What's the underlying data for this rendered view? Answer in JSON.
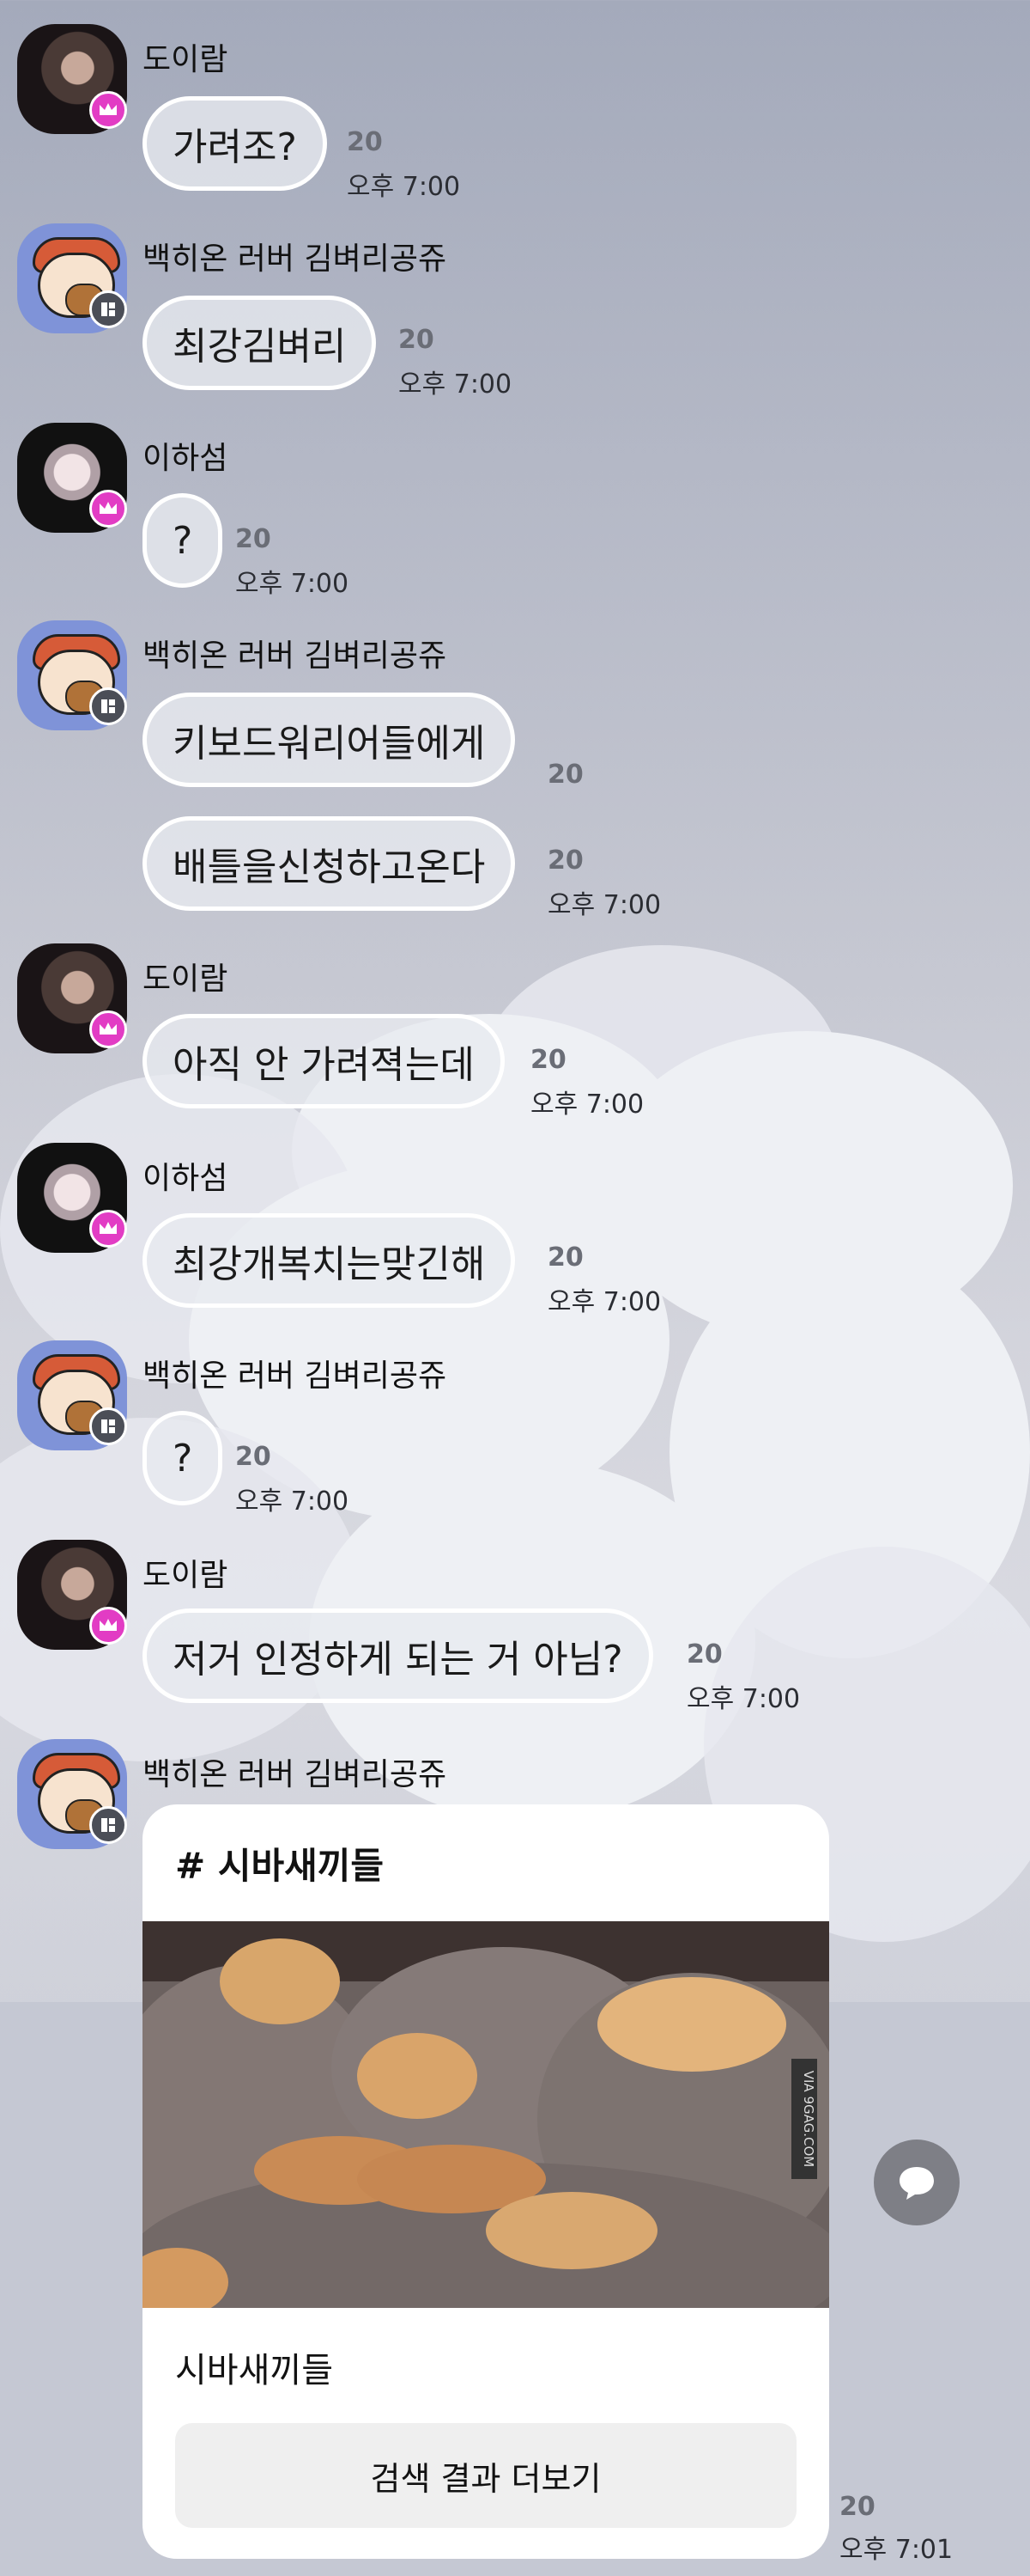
{
  "messages": [
    {
      "sender": "도이람",
      "text": "가려조?",
      "count": "20",
      "time": "오후 7:00"
    },
    {
      "sender": "백히온 러버 김벼리공쥬",
      "text": "최강김벼리",
      "count": "20",
      "time": "오후 7:00"
    },
    {
      "sender": "이하섬",
      "text": "?",
      "count": "20",
      "time": "오후 7:00"
    },
    {
      "sender": "백히온 러버 김벼리공쥬",
      "text": "키보드워리어들에게",
      "count": "20",
      "time": ""
    },
    {
      "sender": "",
      "text": "배틀을신청하고온다",
      "count": "20",
      "time": "오후 7:00"
    },
    {
      "sender": "도이람",
      "text": "아직 안 가려젹는데",
      "count": "20",
      "time": "오후 7:00"
    },
    {
      "sender": "이하섬",
      "text": "최강개복치는맞긴해",
      "count": "20",
      "time": "오후 7:00"
    },
    {
      "sender": "백히온 러버 김벼리공쥬",
      "text": "?",
      "count": "20",
      "time": "오후 7:00"
    },
    {
      "sender": "도이람",
      "text": "저거 인정하게 되는 거 아님?",
      "count": "20",
      "time": "오후 7:00"
    }
  ],
  "card": {
    "sender": "백히온 러버 김벼리공쥬",
    "hashtag": "# 시바새끼들",
    "watermark": "VIA 9GAG.COM",
    "caption": "시바새끼들",
    "button": "검색 결과 더보기",
    "count": "20",
    "time": "오후 7:01"
  },
  "colors": {
    "crown_badge": "#e23cc4",
    "grid_badge": "#4b4e57",
    "bubble_border": "#ffffff"
  }
}
